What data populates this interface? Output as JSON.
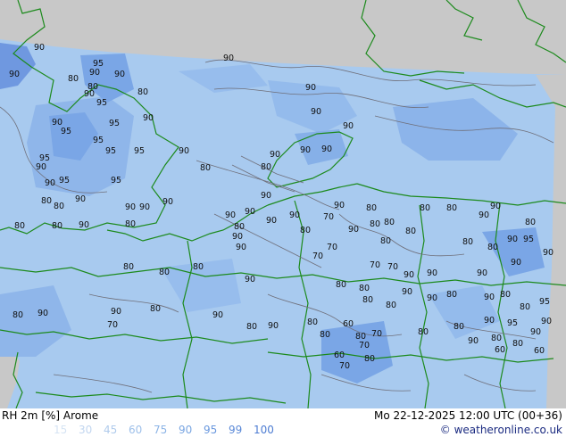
{
  "map": {
    "colors": {
      "unavailable": "#c8c8c8",
      "rh_90_95": "#9ec2ec",
      "rh_95_99": "#7aa6e6",
      "rh_99_100": "#5a86dc",
      "rh_80_90": "#aecdf0",
      "coast": "#1c8a1c",
      "isoline": "#6f6f7a"
    },
    "labels": [
      {
        "t": "90"
      },
      {
        "t": "90"
      },
      {
        "t": "95"
      },
      {
        "t": "90"
      },
      {
        "t": "80"
      },
      {
        "t": "90"
      },
      {
        "t": "80"
      },
      {
        "t": "90"
      },
      {
        "t": "95"
      },
      {
        "t": "80"
      },
      {
        "t": "90"
      },
      {
        "t": "95"
      },
      {
        "t": "95"
      },
      {
        "t": "95"
      },
      {
        "t": "95"
      },
      {
        "t": "90"
      },
      {
        "t": "95"
      },
      {
        "t": "90"
      },
      {
        "t": "90"
      },
      {
        "t": "95"
      },
      {
        "t": "90"
      },
      {
        "t": "95"
      },
      {
        "t": "95"
      },
      {
        "t": "90"
      },
      {
        "t": "80"
      },
      {
        "t": "80"
      },
      {
        "t": "80"
      },
      {
        "t": "90"
      },
      {
        "t": "90"
      },
      {
        "t": "90"
      },
      {
        "t": "90"
      },
      {
        "t": "80"
      },
      {
        "t": "80"
      },
      {
        "t": "90"
      },
      {
        "t": "90"
      },
      {
        "t": "90"
      },
      {
        "t": "90"
      },
      {
        "t": "90"
      },
      {
        "t": "90"
      },
      {
        "t": "80"
      },
      {
        "t": "80"
      },
      {
        "t": "90"
      },
      {
        "t": "90"
      },
      {
        "t": "90"
      },
      {
        "t": "90"
      },
      {
        "t": "80"
      },
      {
        "t": "90"
      },
      {
        "t": "90"
      },
      {
        "t": "80"
      },
      {
        "t": "90"
      },
      {
        "t": "90"
      },
      {
        "t": "90"
      },
      {
        "t": "90"
      },
      {
        "t": "80"
      },
      {
        "t": "80"
      },
      {
        "t": "80"
      },
      {
        "t": "80"
      },
      {
        "t": "80"
      },
      {
        "t": "80"
      },
      {
        "t": "70"
      },
      {
        "t": "70"
      },
      {
        "t": "70"
      },
      {
        "t": "80"
      },
      {
        "t": "80"
      },
      {
        "t": "90"
      },
      {
        "t": "90"
      },
      {
        "t": "80"
      },
      {
        "t": "80"
      },
      {
        "t": "90"
      },
      {
        "t": "95"
      },
      {
        "t": "90"
      },
      {
        "t": "90"
      },
      {
        "t": "80"
      },
      {
        "t": "80"
      },
      {
        "t": "80"
      },
      {
        "t": "90"
      },
      {
        "t": "70"
      },
      {
        "t": "70"
      },
      {
        "t": "80"
      },
      {
        "t": "80"
      },
      {
        "t": "90"
      },
      {
        "t": "90"
      },
      {
        "t": "80"
      },
      {
        "t": "90"
      },
      {
        "t": "90"
      },
      {
        "t": "80"
      },
      {
        "t": "80"
      },
      {
        "t": "90"
      },
      {
        "t": "90"
      },
      {
        "t": "90"
      },
      {
        "t": "95"
      },
      {
        "t": "80"
      },
      {
        "t": "80"
      },
      {
        "t": "95"
      },
      {
        "t": "90"
      },
      {
        "t": "80"
      },
      {
        "t": "90"
      },
      {
        "t": "70"
      },
      {
        "t": "80"
      },
      {
        "t": "90"
      },
      {
        "t": "80"
      },
      {
        "t": "90"
      },
      {
        "t": "80"
      },
      {
        "t": "80"
      },
      {
        "t": "60"
      },
      {
        "t": "70"
      },
      {
        "t": "80"
      },
      {
        "t": "80"
      },
      {
        "t": "90"
      },
      {
        "t": "80"
      },
      {
        "t": "60"
      },
      {
        "t": "80"
      },
      {
        "t": "90"
      },
      {
        "t": "90"
      },
      {
        "t": "80"
      },
      {
        "t": "70"
      },
      {
        "t": "60"
      },
      {
        "t": "70"
      },
      {
        "t": "80"
      },
      {
        "t": "60"
      },
      {
        "t": "80"
      },
      {
        "t": "80"
      },
      {
        "t": "80"
      },
      {
        "t": "80"
      }
    ]
  },
  "footer": {
    "title": "RH 2m [%] Arome",
    "date": "Mo 22-12-2025 12:00 UTC (00+36)",
    "legend": [
      {
        "v": "15",
        "c": "#d6e4f4"
      },
      {
        "v": "30",
        "c": "#c2d6f0"
      },
      {
        "v": "45",
        "c": "#b0cbec"
      },
      {
        "v": "60",
        "c": "#9ec0ea"
      },
      {
        "v": "75",
        "c": "#8cb4e6"
      },
      {
        "v": "90",
        "c": "#7aa6e2"
      },
      {
        "v": "95",
        "c": "#6a98de"
      },
      {
        "v": "99",
        "c": "#5c8ad8"
      },
      {
        "v": "100",
        "c": "#4d7cd2"
      }
    ],
    "credit": "© weatheronline.co.uk"
  }
}
